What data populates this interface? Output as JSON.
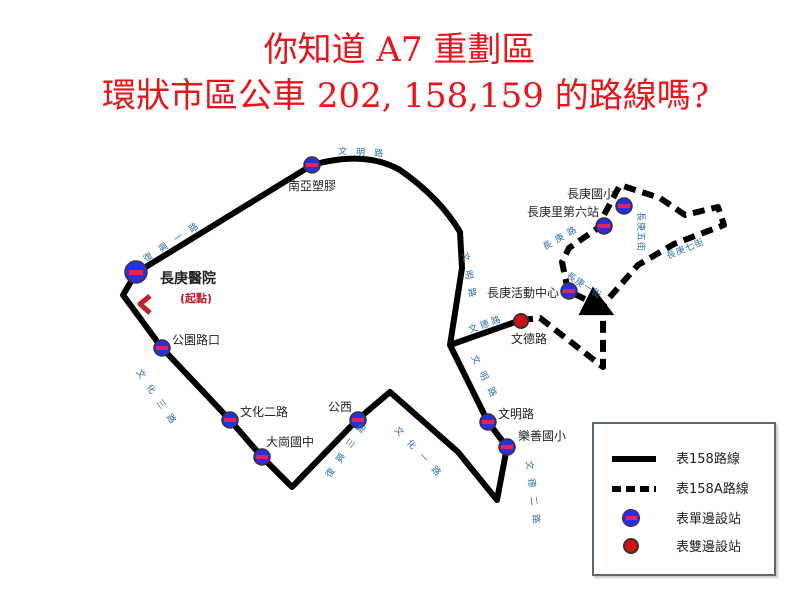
{
  "title": {
    "line1": "你知道 A7 重劃區",
    "line2": "環狀市區公車 202, 158,159 的路線嗎?"
  },
  "stops": {
    "changgung_hospital": "長庚醫院",
    "start_note": "(起點)",
    "nanya_plastics": "南亞塑膠",
    "park_road": "公園路口",
    "wenhua_2nd_rd": "文化二路",
    "dagang_junior_high": "大崗國中",
    "gongxi": "公西",
    "wenming_rd": "文明路",
    "leshan_elementary": "樂善國小",
    "wende_rd": "文德路",
    "changgung_activity_center": "長庚活動中心",
    "changgeng_village_6th": "長庚里第六站",
    "changgeng_elementary": "長庚國小"
  },
  "roads": {
    "fuxing_1st_rd": "復興一路",
    "wenming_rd_north": "文明路",
    "wenming_rd_mid": "文明路",
    "wenming_rd_south": "文明路",
    "wenhua_3rd_rd": "文化三路",
    "fuxing_3rd_rd": "復興三路",
    "wenhua_1st_rd": "文化一路",
    "wende_2nd_rd": "文德二路",
    "wende_rd": "文德路",
    "changgeng_rd": "長庚路",
    "changgeng_1st_st": "長庚一街",
    "changgeng_5th_st": "長庚五街",
    "changgeng_7th_st": "長庚七街"
  },
  "legend": {
    "route158": "表158路線",
    "route158a": "表158A路線",
    "single_side_stop": "表單邊設站",
    "double_side_stop": "表雙邊設站"
  },
  "colors": {
    "title": "#e8141b",
    "route": "#000000",
    "single_side_stop": "#2a2fe0",
    "double_side_stop": "#d40f0f",
    "road_label": "#2f6fa8",
    "start_note": "#c0202a"
  }
}
